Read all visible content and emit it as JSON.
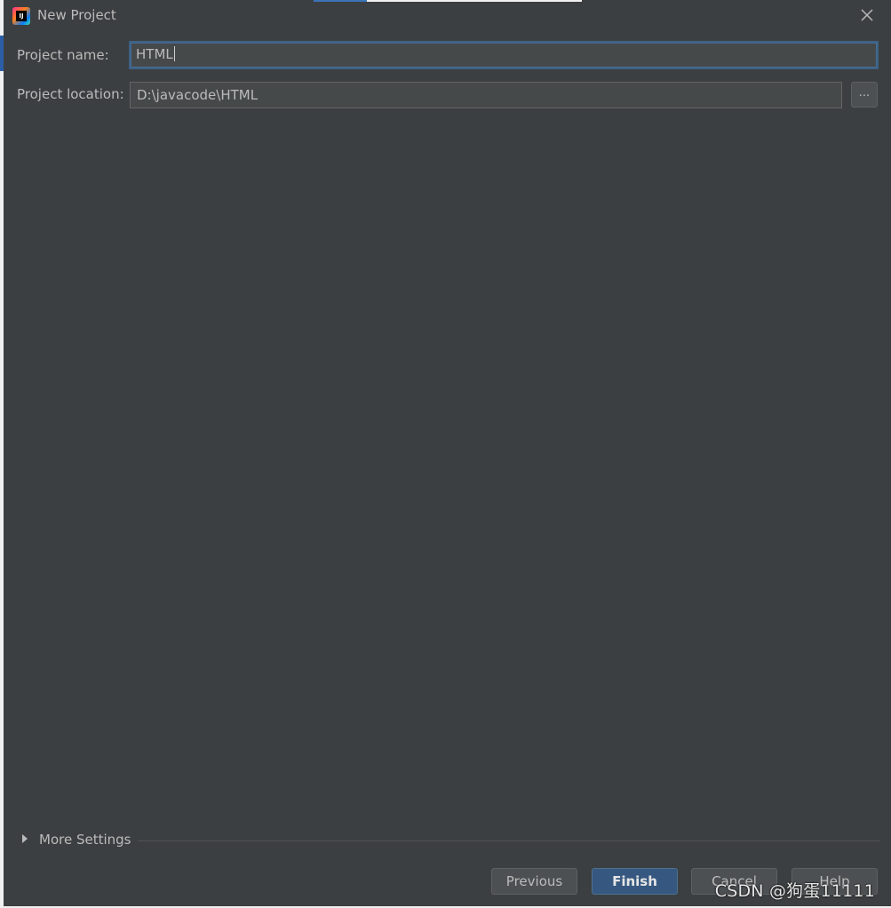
{
  "dialog": {
    "title": "New Project",
    "close_icon": "close-icon",
    "app_icon": "intellij-idea-icon",
    "app_icon_text": "IJ"
  },
  "form": {
    "project_name_label": "Project name:",
    "project_name_value": "HTML",
    "project_location_label": "Project location:",
    "project_location_value": "D:\\javacode\\HTML",
    "browse_label": "..."
  },
  "more_settings": {
    "label": "More Settings",
    "expand_icon": "triangle-right-icon"
  },
  "buttons": {
    "previous": "Previous",
    "finish": "Finish",
    "cancel": "Cancel",
    "help": "Help"
  },
  "watermark": "CSDN @狗蛋11111",
  "colors": {
    "background": "#3c3f41",
    "input_bg": "#45494a",
    "focus_border": "#3d6185",
    "primary_button": "#365880",
    "text": "#bbbbbb"
  }
}
